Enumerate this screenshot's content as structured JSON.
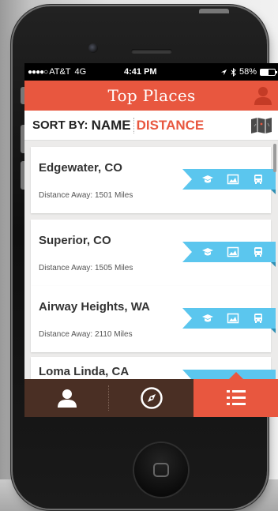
{
  "status_bar": {
    "signal_dots": "●●●●○",
    "carrier": "AT&T",
    "network": "4G",
    "time": "4:41 PM",
    "battery_text": "58%",
    "battery_level": 0.58,
    "icons": [
      "location-arrow-icon",
      "bluetooth-icon",
      "battery-icon"
    ]
  },
  "header": {
    "title": "Top Places",
    "profile_icon": "person-icon"
  },
  "sort": {
    "label": "SORT BY:",
    "option_name": "NAME",
    "option_distance": "DISTANCE",
    "map_icon": "map-icon"
  },
  "places": [
    {
      "name": "Edgewater, CO",
      "distance": "Distance Away: 1501 Miles"
    },
    {
      "name": "Superior, CO",
      "distance": "Distance Away: 1505 Miles"
    },
    {
      "name": "Airway Heights, WA",
      "distance": "Distance Away: 2110 Miles"
    },
    {
      "name": "Loma Linda, CA",
      "distance": ""
    }
  ],
  "ribbon_icons": [
    "graduation-cap-icon",
    "image-icon",
    "bus-icon"
  ],
  "tabs": [
    {
      "icon": "person-icon",
      "active": false
    },
    {
      "icon": "compass-icon",
      "active": false
    },
    {
      "icon": "list-icon",
      "active": true
    }
  ],
  "colors": {
    "accent": "#e8573f",
    "ribbon": "#5bc6ee",
    "tabbar": "#4a2f24"
  }
}
